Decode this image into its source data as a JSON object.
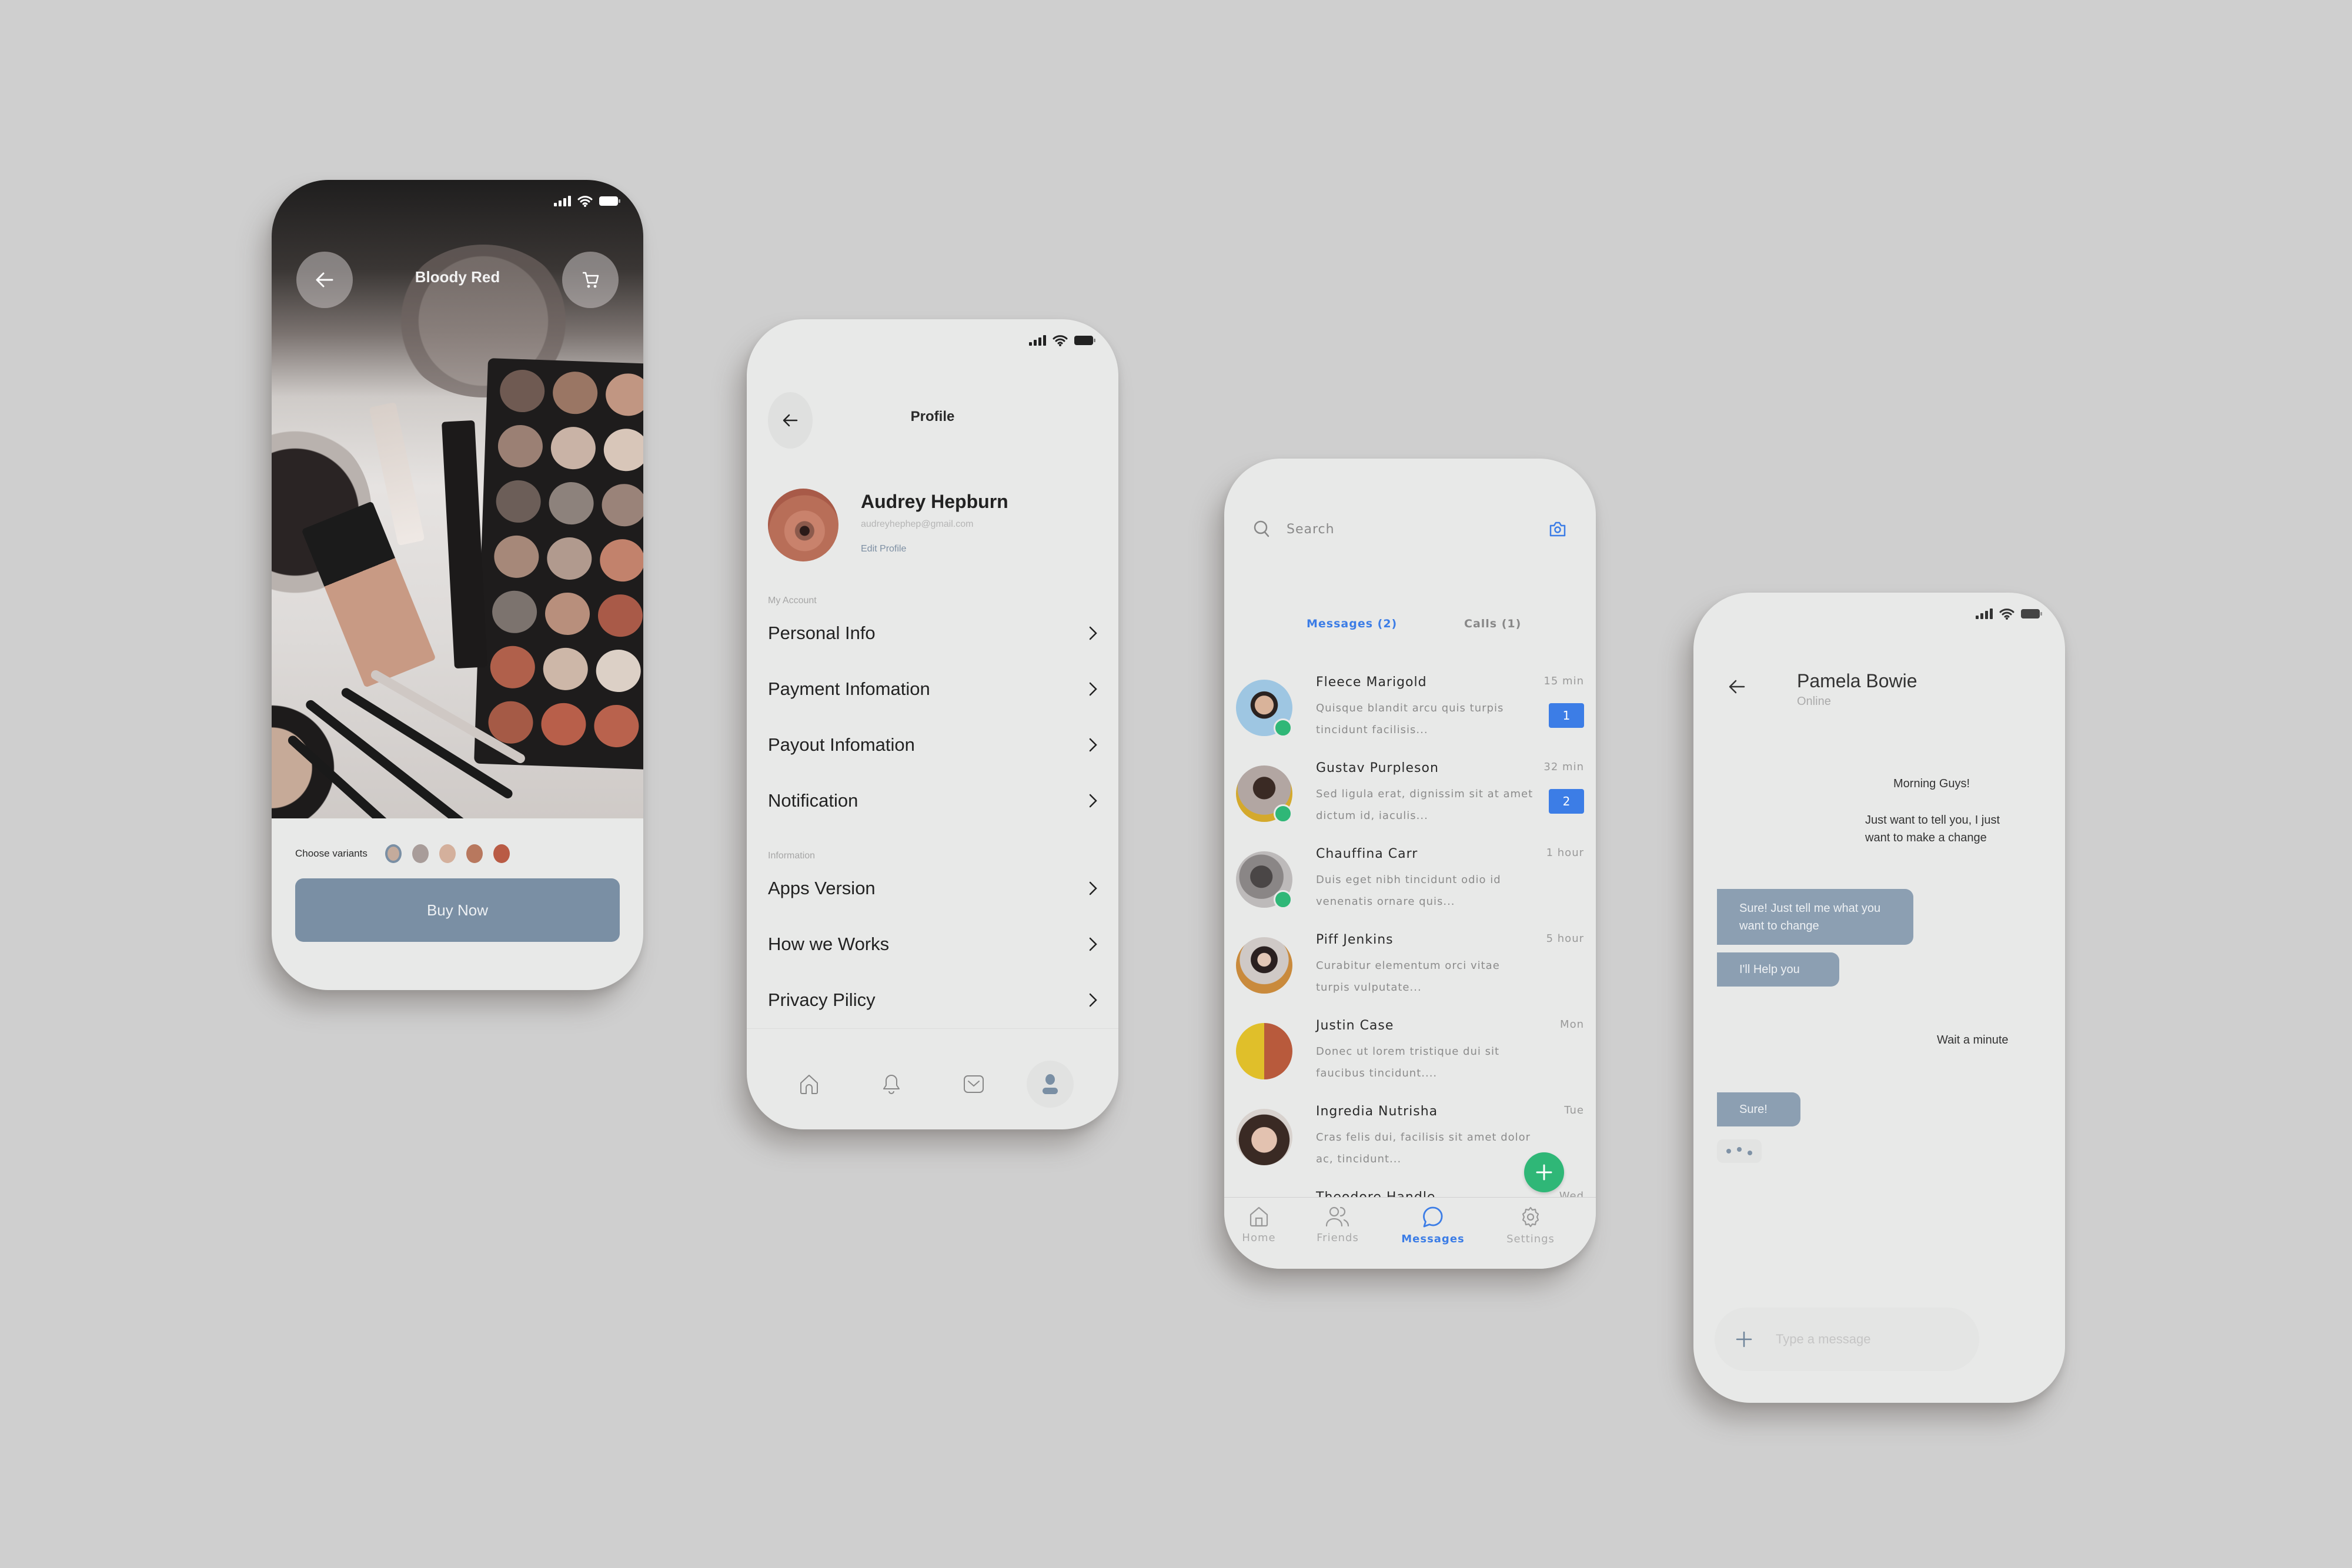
{
  "status_bar": {
    "signal": "signal-icon",
    "wifi": "wifi-icon",
    "battery": "battery-icon"
  },
  "product": {
    "title": "Bloody Red",
    "back_icon": "arrow-left-icon",
    "cart_icon": "cart-icon",
    "variants_label": "Choose variants",
    "variants": [
      {
        "name": "variant-1",
        "color": "#c4ab9c",
        "selected": true,
        "ring": "#7a8fa4"
      },
      {
        "name": "variant-2",
        "color": "#a89c99",
        "selected": false
      },
      {
        "name": "variant-3",
        "color": "#d4b09c",
        "selected": false
      },
      {
        "name": "variant-4",
        "color": "#b8785e",
        "selected": false
      },
      {
        "name": "variant-5",
        "color": "#b95b45",
        "selected": false
      }
    ],
    "buy_label": "Buy Now",
    "accent": "#7a8fa4"
  },
  "profile": {
    "title": "Profile",
    "name": "Audrey Hepburn",
    "email": "audreyhephep@gmail.com",
    "edit_label": "Edit Profile",
    "sections": [
      {
        "label": "My Account",
        "items": [
          "Personal Info",
          "Payment Infomation",
          "Payout Infomation",
          "Notification"
        ]
      },
      {
        "label": "Information",
        "items": [
          "Apps Version",
          "How we Works",
          "Privacy Pilicy"
        ]
      }
    ],
    "tabs": [
      {
        "icon": "home-icon",
        "active": false
      },
      {
        "icon": "bell-icon",
        "active": false
      },
      {
        "icon": "mail-icon",
        "active": false
      },
      {
        "icon": "user-icon",
        "active": true
      }
    ]
  },
  "messages": {
    "search_placeholder": "Search",
    "tabs": [
      {
        "label": "Messages (2)",
        "active": true
      },
      {
        "label": "Calls (1)",
        "active": false
      }
    ],
    "accent": "#3c7de6",
    "online_color": "#2fb777",
    "conversations": [
      {
        "name": "Fleece Marigold",
        "preview": "Quisque blandit arcu quis turpis tincidunt facilisis...",
        "time": "15 min",
        "unread": "1",
        "online": true
      },
      {
        "name": "Gustav Purpleson",
        "preview": "Sed ligula erat, dignissim sit at amet dictum id, iaculis...",
        "time": "32 min",
        "unread": "2",
        "online": true
      },
      {
        "name": "Chauffina Carr",
        "preview": "Duis eget nibh tincidunt odio id venenatis ornare quis...",
        "time": "1 hour",
        "unread": null,
        "online": true
      },
      {
        "name": "Piff Jenkins",
        "preview": "Curabitur elementum orci vitae turpis vulputate...",
        "time": "5 hour",
        "unread": null,
        "online": false
      },
      {
        "name": "Justin Case",
        "preview": "Donec ut lorem tristique dui sit faucibus tincidunt....",
        "time": "Mon",
        "unread": null,
        "online": false
      },
      {
        "name": "Ingredia Nutrisha",
        "preview": "Cras felis dui, facilisis sit amet dolor ac, tincidunt...",
        "time": "Tue",
        "unread": null,
        "online": false
      },
      {
        "name": "Theodore Handle",
        "preview": "",
        "time": "Wed",
        "unread": null,
        "online": false
      }
    ],
    "nav": [
      {
        "label": "Home",
        "icon": "home-icon",
        "active": false
      },
      {
        "label": "Friends",
        "icon": "friends-icon",
        "active": false
      },
      {
        "label": "Messages",
        "icon": "chat-bubble-icon",
        "active": true
      },
      {
        "label": "Settings",
        "icon": "gear-icon",
        "active": false
      }
    ]
  },
  "chat": {
    "contact_name": "Pamela Bowie",
    "contact_status": "Online",
    "messages": [
      {
        "from": "contact",
        "text": "Morning Guys!"
      },
      {
        "from": "contact",
        "text": "Just want to tell you, I just want to make a change"
      },
      {
        "from": "me",
        "text": "Sure! Just tell me what you want to change"
      },
      {
        "from": "me",
        "text": "I'll Help you"
      },
      {
        "from": "contact",
        "text": "Wait a minute"
      },
      {
        "from": "me",
        "text": "Sure!"
      }
    ],
    "typing_indicator": true,
    "compose_placeholder": "Type a message",
    "bubble_color": "#8c9fb2"
  }
}
